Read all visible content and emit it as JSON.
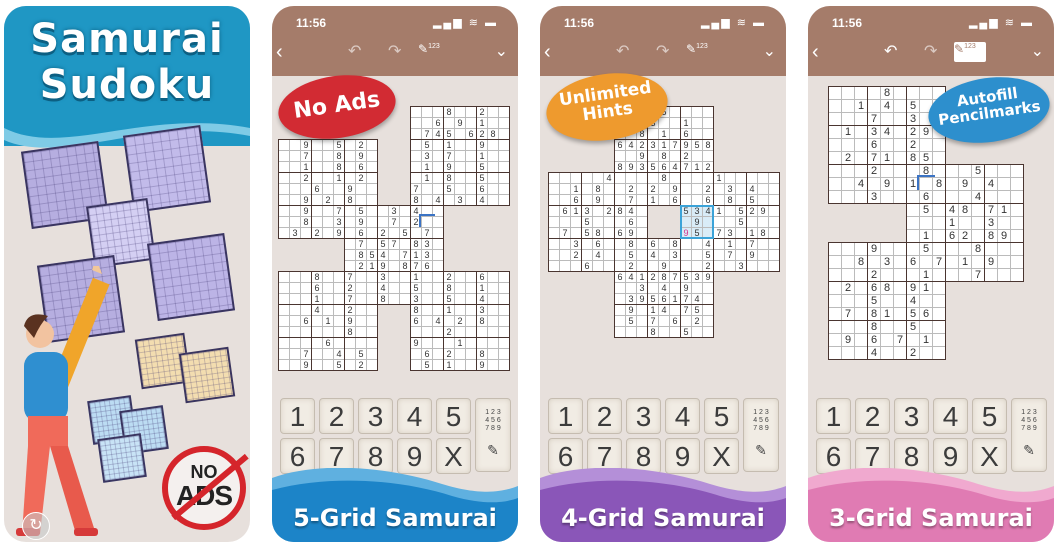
{
  "cards": [
    {
      "type": "hero",
      "title_line1": "Samurai",
      "title_line2": "Sudoku",
      "colors": {
        "header": "#1f97c4",
        "accent": "#d5252b"
      },
      "badge": {
        "line1": "NO",
        "line2": "ADS"
      },
      "replay_icon": "replay-icon"
    },
    {
      "type": "phone",
      "clock": "11:56",
      "status_icons": "▂▄▆ ≋ ▬",
      "toolbar": {
        "back": "‹",
        "undo": "↶",
        "redo": "↷",
        "pencil": "✎",
        "pencil_sup": "123",
        "collapse": "⌄",
        "pencil_active": false
      },
      "promo": {
        "text_line1": "No Ads",
        "text_line2": "",
        "color": "#d22b33"
      },
      "keypad": {
        "keys": [
          "1",
          "2",
          "3",
          "4",
          "5",
          "6",
          "7",
          "8",
          "9",
          "X"
        ],
        "pencil_key": "1 2 3\n4 5 6\n7 8 9"
      },
      "banner": {
        "label": "5-Grid Samurai",
        "color": "#1c84c8",
        "light": "#5fb0e0"
      },
      "grid_layout": "5-grid",
      "givens": [
        "82",
        "6 9 1",
        "7 45 6 28",
        "9 5 2 51 9",
        "7 8 9 3 7 1",
        "1 8 6 1 95",
        "2 1 2 1 8 5",
        "6 97 5 6",
        "9 28 8 4 34",
        "97 5 34",
        "83 9 72",
        "32 9 6 25 7",
        "7 5 78 3",
        "8 54 7 1 3",
        "2 1 9 8 7 6",
        "8 7 3 1 2 6",
        "6 24 5 8 1",
        "17 8 35 4",
        "4 2 8 1 3",
        "61 9 642 8"
      ]
    },
    {
      "type": "phone",
      "clock": "11:56",
      "status_icons": "▂▄▆ ≋ ▬",
      "toolbar": {
        "back": "‹",
        "undo": "↶",
        "redo": "↷",
        "pencil": "✎",
        "pencil_sup": "123",
        "collapse": "⌄",
        "pencil_active": false
      },
      "promo": {
        "text_line1": "Unlimited",
        "text_line2": "Hints",
        "color": "#ee9a2e"
      },
      "keypad": {
        "keys": [
          "1",
          "2",
          "3",
          "4",
          "5",
          "6",
          "7",
          "8",
          "9",
          "X"
        ],
        "pencil_key": "1 2 3\n4 5 6\n7 8 9"
      },
      "banner": {
        "label": "4-Grid Samurai",
        "color": "#8a56b8",
        "light": "#b48fd8"
      },
      "grid_layout": "4-grid",
      "hint_highlight_color": "#3ba3d8",
      "hint_digit_color": "#d1338f",
      "givens": [
        "5",
        "31",
        "8 1 6",
        "642 317 958",
        "982",
        "893 564 712",
        "4 8 1",
        "18 2 2 9 2 34",
        "6 9 7 1 6 6 8 5",
        "613 2 845 34 1 529",
        "5 6 9 5",
        "75 8 69 95 73 18",
        "3 6 8 6 8 4 1 7",
        "2 4 5 4 3 5 79",
        "62 9 2 3",
        "641 287 539",
        "349",
        "39 561 74",
        "9 1 4 75",
        "5 7 62",
        "8 5"
      ]
    },
    {
      "type": "phone",
      "clock": "11:56",
      "status_icons": "▂▄▆ ≋ ▬",
      "toolbar": {
        "back": "‹",
        "undo": "↶",
        "redo": "↷",
        "pencil": "✎",
        "pencil_sup": "123",
        "collapse": "⌄",
        "pencil_active": true
      },
      "promo": {
        "text_line1": "Autofill",
        "text_line2": "Pencilmarks",
        "color": "#2d8fcd"
      },
      "keypad": {
        "keys": [
          "1",
          "2",
          "3",
          "4",
          "5",
          "6",
          "7",
          "8",
          "9",
          "X"
        ],
        "pencil_key": "1 2 3\n4 5 6\n7 8 9"
      },
      "banner": {
        "label": "3-Grid Samurai",
        "color": "#e07bb3",
        "light": "#f0a9cf"
      },
      "grid_layout": "3-grid",
      "givens": [
        "8",
        "1 4 5",
        "7 3",
        "13 4 29",
        "6 2",
        "27 1 85",
        "2 8 5",
        "4 9 1 8 9 4",
        "3 6 4",
        "54 8 71",
        "1 3",
        "16 2 89",
        "9 5 8",
        "8 3 6 7 1 9",
        "2 1 7",
        "26 8 91",
        "5 4",
        "78 1 56",
        "8 5",
        "9 6 7 1",
        "4 2"
      ]
    }
  ]
}
